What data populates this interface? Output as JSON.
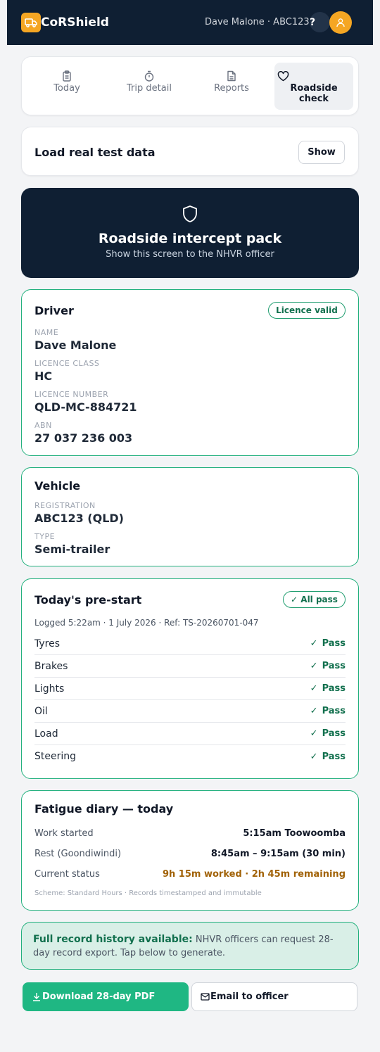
{
  "header": {
    "brand": "CoRShield",
    "user": "Dave Malone · ABC123",
    "help_label": "?"
  },
  "tabs": [
    {
      "label": "Today",
      "icon": "clipboard-icon",
      "active": false
    },
    {
      "label": "Trip detail",
      "icon": "stopwatch-icon",
      "active": false
    },
    {
      "label": "Reports",
      "icon": "document-icon",
      "active": false
    },
    {
      "label": "Roadside check",
      "icon": "heart-icon",
      "active": true
    }
  ],
  "load_data": {
    "title": "Load real test data",
    "button": "Show"
  },
  "hero": {
    "title": "Roadside intercept pack",
    "subtitle": "Show this screen to the NHVR officer"
  },
  "driver": {
    "title": "Driver",
    "badge": "Licence valid",
    "fields": [
      {
        "label": "NAME",
        "value": "Dave Malone"
      },
      {
        "label": "LICENCE CLASS",
        "value": "HC"
      },
      {
        "label": "LICENCE NUMBER",
        "value": "QLD-MC-884721"
      },
      {
        "label": "ABN",
        "value": "27 037 236 003"
      }
    ]
  },
  "vehicle": {
    "title": "Vehicle",
    "fields": [
      {
        "label": "REGISTRATION",
        "value": "ABC123 (QLD)"
      },
      {
        "label": "TYPE",
        "value": "Semi-trailer"
      }
    ]
  },
  "prestart": {
    "title": "Today's pre-start",
    "badge": "✓ All pass",
    "logged": "Logged 5:22am · 1 July 2026 · Ref: TS-20260701-047",
    "checks": [
      {
        "item": "Tyres",
        "result": "Pass"
      },
      {
        "item": "Brakes",
        "result": "Pass"
      },
      {
        "item": "Lights",
        "result": "Pass"
      },
      {
        "item": "Oil",
        "result": "Pass"
      },
      {
        "item": "Load",
        "result": "Pass"
      },
      {
        "item": "Steering",
        "result": "Pass"
      }
    ],
    "tick": "✓"
  },
  "fatigue": {
    "title": "Fatigue diary — today",
    "rows": [
      {
        "label": "Work started",
        "value": "5:15am Toowoomba"
      },
      {
        "label": "Rest (Goondiwindi)",
        "value": "8:45am – 9:15am (30 min)"
      },
      {
        "label": "Current status",
        "value": "9h 15m worked · 2h 45m remaining"
      }
    ],
    "scheme": "Scheme: Standard Hours · Records timestamped and immutable"
  },
  "notice": {
    "strong": "Full record history available:",
    "text": " NHVR officers can request 28-day record export. Tap below to generate."
  },
  "actions": {
    "pdf": "Download 28-day PDF",
    "email": "Email to officer"
  },
  "colors": {
    "navy": "#0f1f33",
    "accent": "#f5a623",
    "green": "#1fb783",
    "pass_green": "#12704e",
    "amber": "#a16207"
  }
}
